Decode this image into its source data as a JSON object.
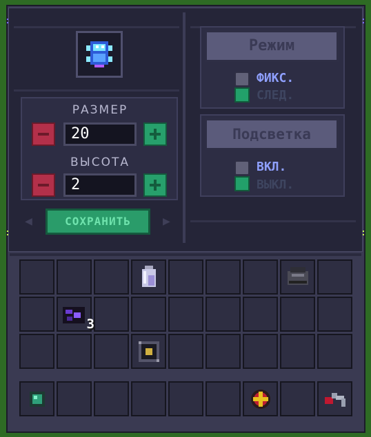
{
  "screen": {
    "size": {
      "label": "РАЗМЕР",
      "value": "20"
    },
    "height": {
      "label": "ВЫСОТА",
      "value": "2"
    },
    "save_label": "СОХРАНИТЬ",
    "mode": {
      "button_label": "Режим",
      "option_active": "ФИКС.",
      "option_inactive": "СЛЕД."
    },
    "highlight": {
      "button_label": "Подсветка",
      "option_active": "ВКЛ.",
      "option_inactive": "ВЫКЛ."
    }
  },
  "inventory": {
    "rows": 3,
    "cols": 9,
    "items": [
      {
        "row": 0,
        "col": 3,
        "icon": "glass-bottle-icon"
      },
      {
        "row": 0,
        "col": 7,
        "icon": "anvil-block-icon"
      },
      {
        "row": 1,
        "col": 1,
        "icon": "dark-crystal-block-icon",
        "count": "3"
      },
      {
        "row": 2,
        "col": 3,
        "icon": "machine-frame-icon"
      }
    ]
  },
  "hotbar": {
    "items": [
      {
        "col": 0,
        "icon": "green-gem-icon"
      },
      {
        "col": 6,
        "icon": "red-yellow-orb-icon"
      },
      {
        "col": 8,
        "icon": "wrench-tool-icon"
      }
    ]
  }
}
